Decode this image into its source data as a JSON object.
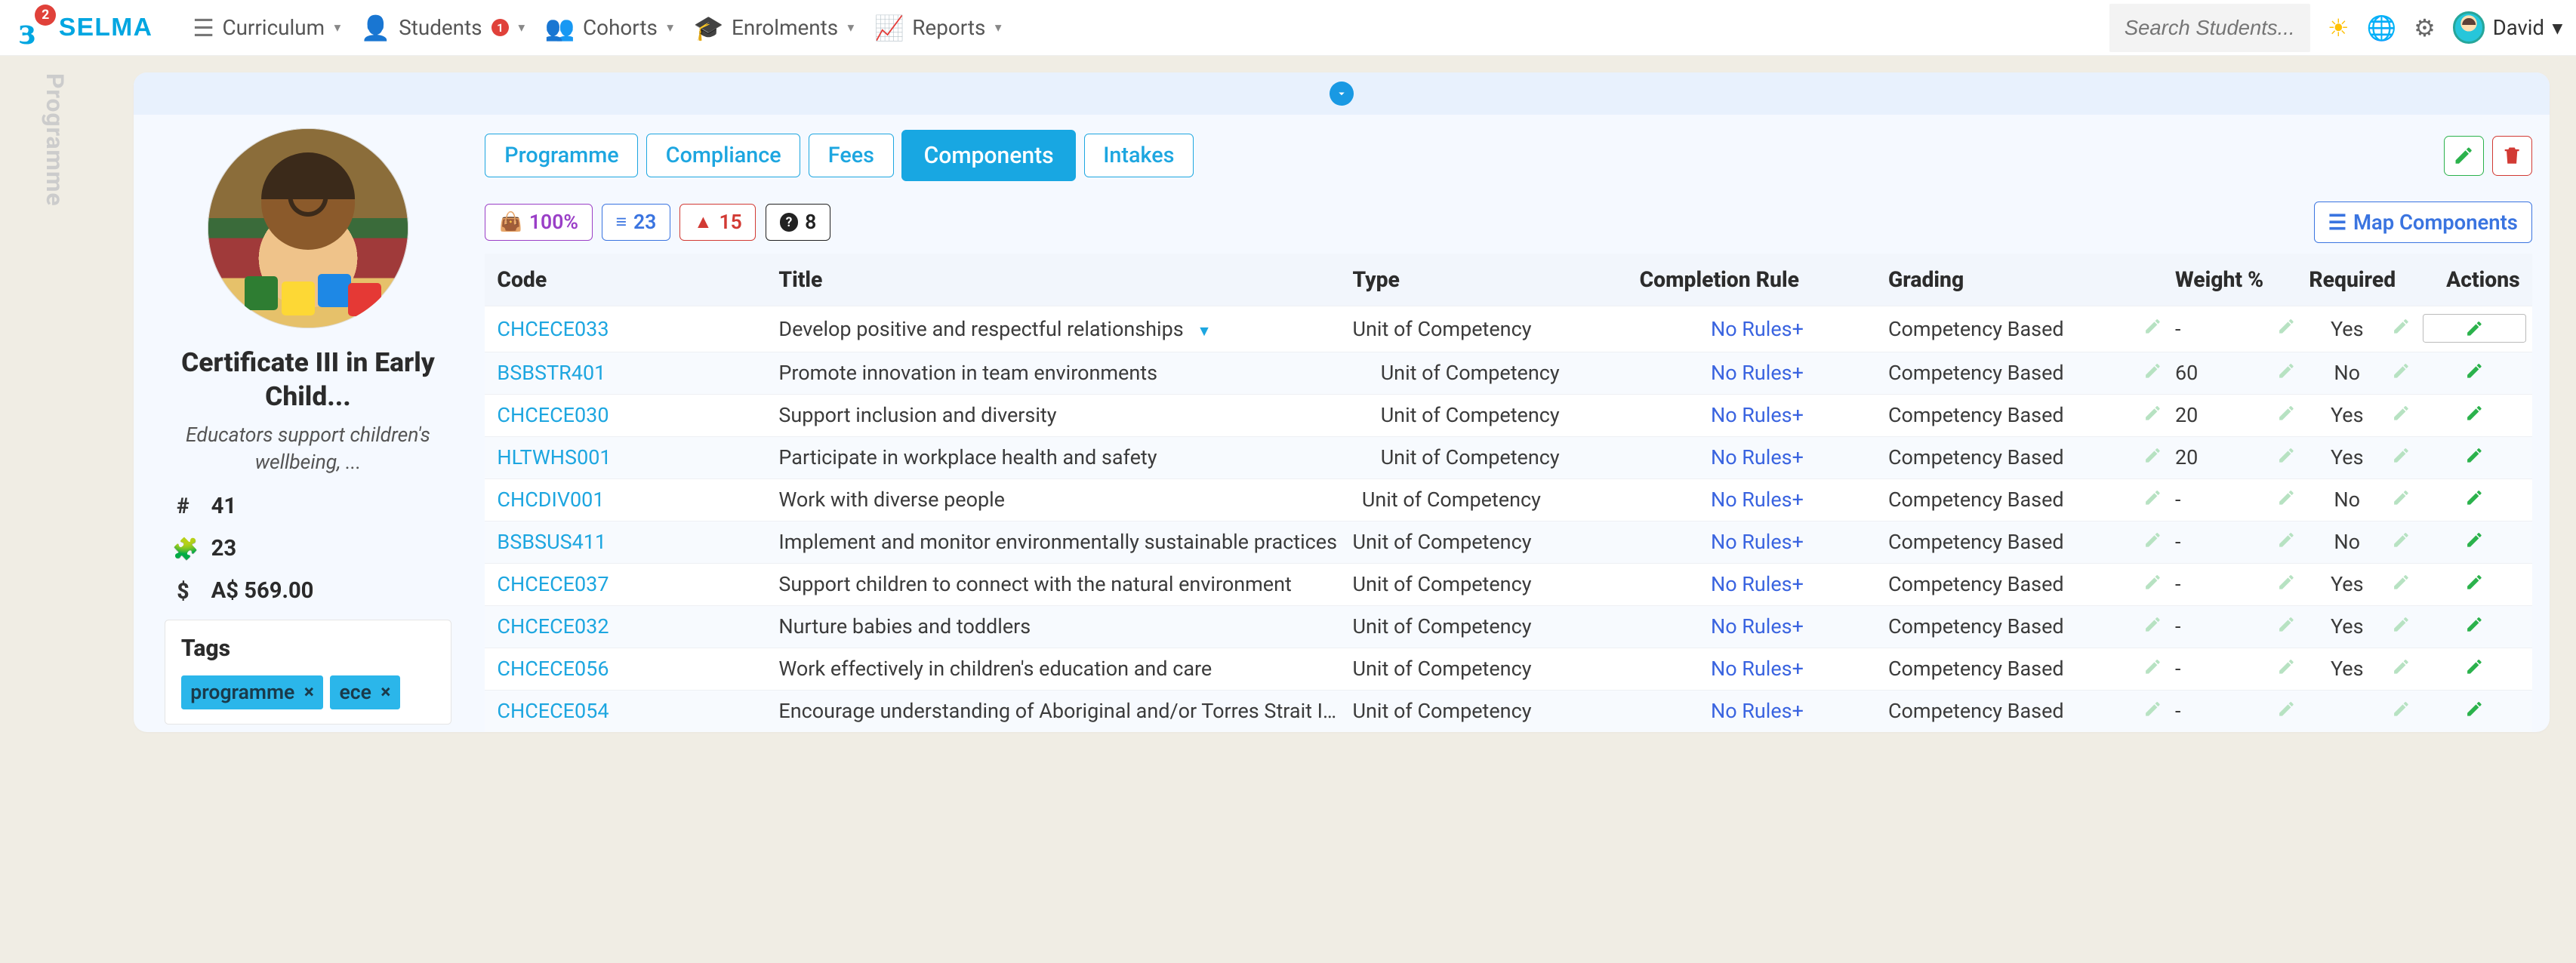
{
  "brand": "SELMA",
  "logo_badge": "2",
  "nav": {
    "curriculum": "Curriculum",
    "students": "Students",
    "students_badge": "1",
    "cohorts": "Cohorts",
    "enrolments": "Enrolments",
    "reports": "Reports"
  },
  "search_placeholder": "Search Students...",
  "user_name": "David",
  "vertical_label": "Programme",
  "programme": {
    "title": "Certificate III in Early Child...",
    "subtitle": "Educators support children's wellbeing, ...",
    "stat_count": "41",
    "stat_units": "23",
    "price": "A$ 569.00",
    "tags_heading": "Tags",
    "tags": [
      {
        "label": "programme"
      },
      {
        "label": "ece"
      }
    ]
  },
  "tabs": {
    "programme": "Programme",
    "compliance": "Compliance",
    "fees": "Fees",
    "components": "Components",
    "intakes": "Intakes"
  },
  "chips": {
    "purple": "100%",
    "blue": "23",
    "red": "15",
    "black": "8"
  },
  "map_btn": "Map Components",
  "table": {
    "headers": {
      "code": "Code",
      "title": "Title",
      "type": "Type",
      "rule": "Completion Rule",
      "grading": "Grading",
      "weight": "Weight %",
      "required": "Required",
      "actions": "Actions"
    },
    "rows": [
      {
        "code": "CHCECE033",
        "title": "Develop positive and respectful relationships",
        "type": "Unit of Competency",
        "rule": "No Rules+",
        "grading": "Competency Based",
        "weight": "-",
        "required": "Yes",
        "type_pad": 0,
        "selected": true,
        "sort": true
      },
      {
        "code": "BSBSTR401",
        "title": "Promote innovation in team environments",
        "type": "Unit of Competency",
        "rule": "No Rules+",
        "grading": "Competency Based",
        "weight": "60",
        "required": "No",
        "type_pad": 2
      },
      {
        "code": "CHCECE030",
        "title": "Support inclusion and diversity",
        "type": "Unit of Competency",
        "rule": "No Rules+",
        "grading": "Competency Based",
        "weight": "20",
        "required": "Yes",
        "type_pad": 2
      },
      {
        "code": "HLTWHS001",
        "title": "Participate in workplace health and safety",
        "type": "Unit of Competency",
        "rule": "No Rules+",
        "grading": "Competency Based",
        "weight": "20",
        "required": "Yes",
        "type_pad": 2
      },
      {
        "code": "CHCDIV001",
        "title": "Work with diverse people",
        "type": "Unit of Competency",
        "rule": "No Rules+",
        "grading": "Competency Based",
        "weight": "-",
        "required": "No",
        "type_pad": 1
      },
      {
        "code": "BSBSUS411",
        "title": "Implement and monitor environmentally sustainable practices",
        "type": "Unit of Competency",
        "rule": "No Rules+",
        "grading": "Competency Based",
        "weight": "-",
        "required": "No",
        "type_pad": 0
      },
      {
        "code": "CHCECE037",
        "title": "Support children to connect with the natural environment",
        "type": "Unit of Competency",
        "rule": "No Rules+",
        "grading": "Competency Based",
        "weight": "-",
        "required": "Yes",
        "type_pad": 0
      },
      {
        "code": "CHCECE032",
        "title": "Nurture babies and toddlers",
        "type": "Unit of Competency",
        "rule": "No Rules+",
        "grading": "Competency Based",
        "weight": "-",
        "required": "Yes",
        "type_pad": 0
      },
      {
        "code": "CHCECE056",
        "title": "Work effectively in children's education and care",
        "type": "Unit of Competency",
        "rule": "No Rules+",
        "grading": "Competency Based",
        "weight": "-",
        "required": "Yes",
        "type_pad": 0
      },
      {
        "code": "CHCECE054",
        "title": "Encourage understanding of Aboriginal and/or Torres Strait Islander cultures",
        "type": "Unit of Competency",
        "rule": "No Rules+",
        "grading": "Competency Based",
        "weight": "-",
        "required": "",
        "type_pad": 0
      }
    ]
  }
}
